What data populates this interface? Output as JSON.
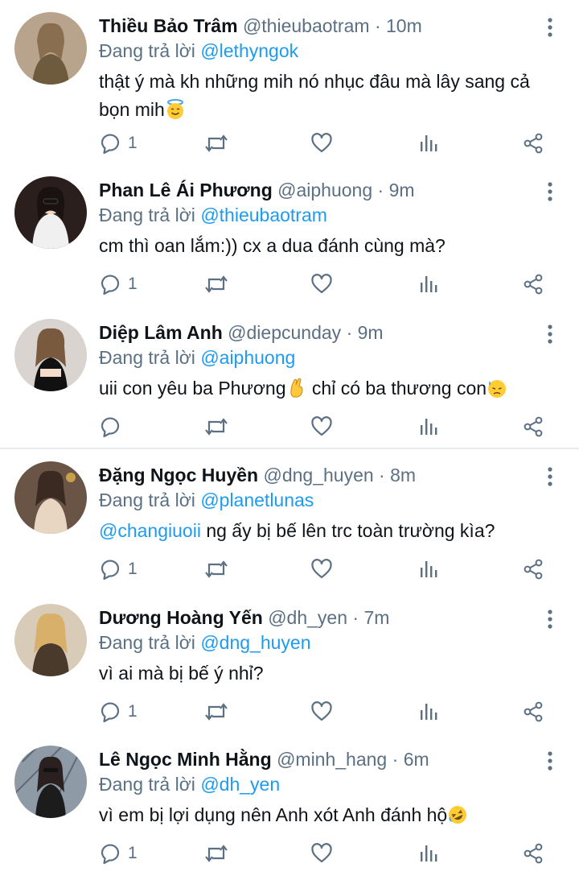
{
  "colors": {
    "accent": "#1d9bf0",
    "muted": "#5b7083",
    "text": "#0f1419"
  },
  "reply_prefix": "Đang trả lời",
  "tweets": [
    {
      "name": "Thiều Bảo Trâm",
      "handle": "@thieubaotram",
      "time": "10m",
      "reply_to": "@lethyngok",
      "text_mention": "",
      "text": "thật ý mà kh những mih nó nhục đâu mà lây sang cả bọn mih",
      "emoji": "smiling-face-with-halo",
      "reply_count": "1"
    },
    {
      "name": "Phan Lê Ái Phương",
      "handle": "@aiphuong",
      "time": "9m",
      "reply_to": "@thieubaotram",
      "text_mention": "",
      "text": "cm thì oan lắm:)) cx a dua đánh cùng mà?",
      "emoji": "",
      "reply_count": "1"
    },
    {
      "name": "Diệp Lâm Anh",
      "handle": "@diepcunday",
      "time": "9m",
      "reply_to": "@aiphuong",
      "text_mention": "",
      "text": "uii con yêu ba Phương",
      "text_after": " chỉ có ba thương con",
      "emoji": "crossed-fingers",
      "emoji_end": "downcast-face-with-sweat",
      "reply_count": ""
    },
    {
      "name": "Đặng Ngọc Huyền",
      "handle": "@dng_huyen",
      "time": "8m",
      "reply_to": "@planetlunas",
      "text_mention": "@changiuoii",
      "text": " ng ấy bị bế lên trc toàn trường kìa?",
      "emoji": "",
      "reply_count": "1"
    },
    {
      "name": "Dương Hoàng Yến",
      "handle": "@dh_yen",
      "time": "7m",
      "reply_to": "@dng_huyen",
      "text_mention": "",
      "text": "vì ai mà bị bế ý nhỉ?",
      "emoji": "",
      "reply_count": "1"
    },
    {
      "name": "Lê Ngọc Minh Hằng",
      "handle": "@minh_hang",
      "time": "6m",
      "reply_to": "@dh_yen",
      "text_mention": "",
      "text": "vì em bị lợi dụng nên Anh xót Anh đánh hộ",
      "emoji": "rolling-on-floor-laughing",
      "reply_count": "1"
    }
  ]
}
